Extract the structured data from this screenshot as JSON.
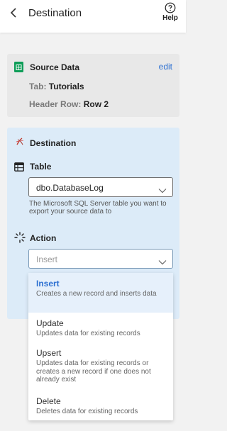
{
  "header": {
    "title": "Destination",
    "help_label": "Help"
  },
  "source": {
    "title": "Source Data",
    "edit_label": "edit",
    "tab_key": "Tab:",
    "tab_value": "Tutorials",
    "header_row_key": "Header Row:",
    "header_row_value": "Row 2"
  },
  "destination": {
    "title": "Destination",
    "table_label": "Table",
    "table_value": "dbo.DatabaseLog",
    "table_help": "The Microsoft SQL Server table you want to export your source data to",
    "action_label": "Action",
    "action_placeholder": "Insert"
  },
  "action_options": [
    {
      "title": "Insert",
      "description": "Creates a new record and inserts data",
      "selected": true
    },
    {
      "title": "Update",
      "description": "Updates data for existing records",
      "selected": false
    },
    {
      "title": "Upsert",
      "description": "Updates data for existing records or creates a new record if one does not already exist",
      "selected": false
    },
    {
      "title": "Delete",
      "description": "Deletes data for existing records",
      "selected": false
    }
  ],
  "colors": {
    "accent": "#2b6fd1",
    "source_card_bg": "#e8e8e8",
    "destination_card_bg": "#dcebf8",
    "sheets_green": "#0f9d58",
    "selected_option_bg": "#e6f0fb"
  },
  "icons": {
    "back": "chevron-left-icon",
    "help": "question-circle-icon",
    "source": "google-sheets-icon",
    "destination": "sql-server-icon",
    "table": "table-icon",
    "action": "sparkle-icon",
    "select_arrow": "chevron-down-icon"
  }
}
